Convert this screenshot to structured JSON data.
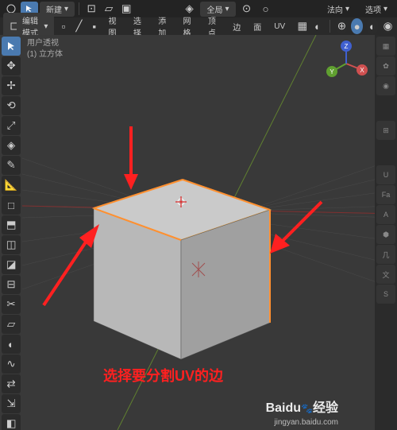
{
  "header": {
    "cursor_icon": "cursor",
    "new_button": "新建",
    "mode": "编辑模式",
    "snap_icon": "magnet",
    "orientation": "全局",
    "direction_label": "法向",
    "select_label": "选项"
  },
  "header2": {
    "menu": [
      "视图",
      "选择",
      "添加",
      "网格",
      "顶点",
      "边",
      "面",
      "UV"
    ]
  },
  "viewport": {
    "info_line1": "用户透视",
    "info_line2": "(1) 立方体"
  },
  "annotation": {
    "text": "选择要分割UV的边"
  },
  "watermark": {
    "brand": "Baidu",
    "product": "经验",
    "url": "jingyan.baidu.com"
  },
  "gizmo": {
    "x": "X",
    "y": "Y",
    "z": "Z"
  },
  "right_tabs": [
    "▦",
    "✿",
    "◉",
    "⊞",
    "U",
    "Fa",
    "A",
    "⬢",
    "几",
    "文",
    "S"
  ]
}
